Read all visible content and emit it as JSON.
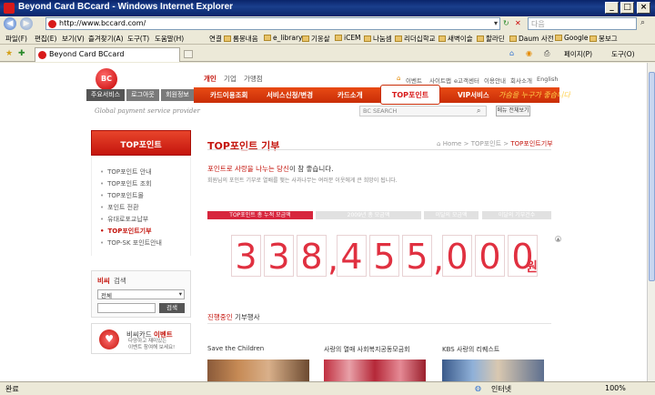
{
  "window": {
    "title": "Beyond Card BCcard - Windows Internet Explorer"
  },
  "address": {
    "url": "http://www.bccard.com/",
    "search_placeholder": "다음"
  },
  "menu": [
    "파일(F)",
    "편집(E)",
    "보기(V)",
    "즐겨찾기(A)",
    "도구(T)",
    "도움말(H)"
  ],
  "links": {
    "label": "연결",
    "items": [
      "롬몽내음",
      "e_library",
      "기옹살",
      "iCEM",
      "나눔셈",
      "리더십학교",
      "새벽이슬",
      "할라딘",
      "Daum 사전",
      "Google",
      "봉보그"
    ]
  },
  "tab": {
    "title": "Beyond Card BCcard"
  },
  "tab_tools": [
    "페이지(P)",
    "도구(O)"
  ],
  "site": {
    "logo": "BC",
    "topnav": [
      "개인",
      "기업",
      "가맹점"
    ],
    "util": [
      "이벤트",
      "사이트맵",
      "e고객센터",
      "이용안내",
      "회사소개",
      "English"
    ],
    "subbtns": [
      "주요서비스",
      "로그아웃",
      "회원정보"
    ],
    "mainnav": [
      "카드이용조회",
      "서비스신청/변경",
      "카드소개",
      "TOP포인트",
      "VIP서비스"
    ],
    "slogan": "가슴을 누구가 좋습니다",
    "tagline": "Global payment service provider",
    "search_placeholder": "BC SEARCH",
    "menu_all": "메뉴 전체보기"
  },
  "sidebar": {
    "title": "TOP포인트",
    "items": [
      {
        "label": "TOP포인트 안내",
        "active": false
      },
      {
        "label": "TOP포인트 조회",
        "active": false
      },
      {
        "label": "TOP포인트몰",
        "active": false
      },
      {
        "label": "포인트 전환",
        "active": false
      },
      {
        "label": "유대로포교납부",
        "active": false
      },
      {
        "label": "TOP포인트기부",
        "active": true
      },
      {
        "label": "TOP-SK 포인트안내",
        "active": false
      }
    ],
    "search": {
      "label_red": "비씨",
      "label": "검색",
      "select_value": "전체",
      "button": "검색"
    },
    "event": {
      "title": "비씨카드",
      "title_red": "이벤트",
      "line1": "다양하고 재미있는",
      "line2": "이벤트 참여해 보세요!"
    }
  },
  "main": {
    "title": "TOP포인트 기부",
    "breadcrumb": {
      "home": "Home",
      "sep": ">",
      "level1": "TOP포인트",
      "current": "TOP포인트기부"
    },
    "headline_red": "포인트로 사랑을 나누는 당신",
    "headline_rest": "이 참 좋습니다.",
    "subline": "회원님의 포인트 기부로 열배를 맺는 사과나무는 여러분 이웃에게 큰 희망이 됩니다.",
    "stat_tabs": [
      "TOP포인트 총 누적 모금액",
      "2009년 총 모금액",
      "이달의 모금액",
      "이달의 기부건수"
    ],
    "amount": "338,455,000",
    "currency": "원",
    "programs_heading_red": "진행중인",
    "programs_heading": "기부행사",
    "programs": [
      "Save the Children",
      "사랑의 열매 사회복지공동모금회",
      "KBS 사랑의 리퀘스트"
    ]
  },
  "status": {
    "left": "완료",
    "zone": "인터넷",
    "zoom": "100%"
  },
  "colors": {
    "brand_red": "#c4150d",
    "nav_orange": "#e84b14",
    "digit_red": "#e03040",
    "xp_title": "#0a246a"
  }
}
